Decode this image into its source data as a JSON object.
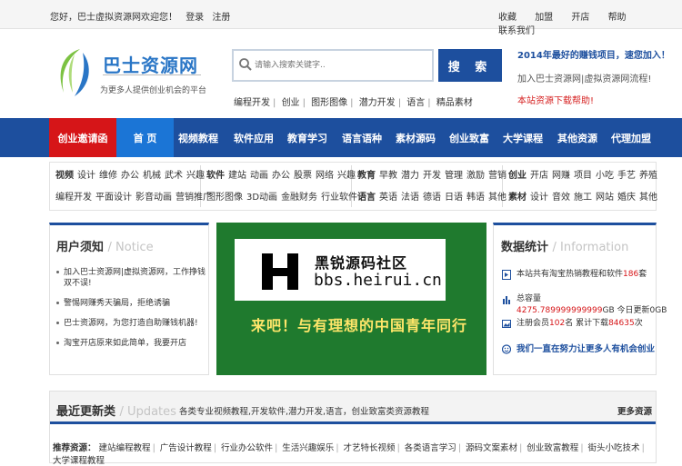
{
  "topbar": {
    "welcome": "您好，巴士虚拟资源网欢迎您！",
    "login": "登录",
    "register": "注册",
    "right_links": [
      "收藏",
      "加盟",
      "开店",
      "帮助",
      "联系我们"
    ]
  },
  "header": {
    "logo_text": "巴士资源网",
    "logo_sub": "为更多人提供创业机会的平台",
    "search_placeholder": "请输入搜索关键字..",
    "search_button": "搜 索",
    "hot_words": [
      "编程开发",
      "创业",
      "图形图像",
      "潜力开发",
      "语言",
      "精品素材"
    ],
    "promo_title": "2014年最好的赚钱项目，速您加入！",
    "promo_line": "加入巴士资源网|虚拟资源网流程!",
    "promo_help": "本站资源下载帮助!"
  },
  "nav": {
    "items": [
      "创业邀请函",
      "首 页",
      "视频教程",
      "软件应用",
      "教育学习",
      "语言语种",
      "素材源码",
      "创业致富",
      "大学课程",
      "其他资源",
      "代理加盟"
    ]
  },
  "categories": [
    {
      "rows": [
        {
          "head": "视频",
          "items": [
            "设计",
            "维修",
            "办公",
            "机械",
            "武术",
            "兴趣"
          ]
        },
        {
          "head": "",
          "items": [
            "编程开发",
            "平面设计",
            "影音动画",
            "营销推广"
          ]
        }
      ]
    },
    {
      "rows": [
        {
          "head": "软件",
          "items": [
            "建站",
            "动画",
            "办公",
            "股票",
            "网络",
            "兴趣"
          ]
        },
        {
          "head": "",
          "items": [
            "图形图像",
            "3D动画",
            "金融财务",
            "行业软件"
          ]
        }
      ]
    },
    {
      "rows": [
        {
          "head": "教育",
          "items": [
            "早教",
            "潜力",
            "开发",
            "管理",
            "激励",
            "营销"
          ]
        },
        {
          "head": "语言",
          "items": [
            "英语",
            "法语",
            "德语",
            "日语",
            "韩语",
            "其他"
          ]
        }
      ]
    },
    {
      "rows": [
        {
          "head": "创业",
          "items": [
            "开店",
            "网赚",
            "项目",
            "小吃",
            "手艺",
            "养殖"
          ]
        },
        {
          "head": "素材",
          "items": [
            "设计",
            "音效",
            "施工",
            "网站",
            "婚庆",
            "其他"
          ]
        }
      ]
    }
  ],
  "notice": {
    "title": "用户须知",
    "title_en": "/ Notice",
    "items": [
      "加入巴士资源网|虚拟资源网，工作挣钱双不误!",
      "警惕网赚秀天骗局，拒绝诱骗",
      "巴士资源网，为您打造自助赚钱机器!",
      "淘宝开店原来如此简单，我要开店"
    ]
  },
  "banner": {
    "logo_letter": "H",
    "cn_name": "黑锐源码社区",
    "url": "bbs.heirui.cn",
    "slogan": "来吧！与有理想的中国青年同行"
  },
  "stats": {
    "title": "数据统计",
    "title_en": "/ Information",
    "line1_pre": "本站共有淘宝热销教程和软件",
    "line1_num": "186",
    "line1_post": "套",
    "line2_pre": "总容量",
    "line2_num": "4275.789999999999",
    "line2_post": "GB 今日更新0GB",
    "line3_pre": "注册会员",
    "line3_num": "102",
    "line3_mid": "名 累计下载",
    "line3_num2": "84635",
    "line3_post": "次",
    "slogan": "我们一直在努力让更多人有机会创业"
  },
  "updates": {
    "title": "最近更新类",
    "title_en": "/ Updates",
    "desc": "各类专业视频教程,开发软件,潜力开发,语言，创业致富类资源教程",
    "more": "更多资源",
    "rec_label": "推荐资源：",
    "links": [
      "建站编程教程",
      "广告设计教程",
      "行业办公软件",
      "生活兴趣娱乐",
      "才艺特长视频",
      "各类语言学习",
      "源码文案素材",
      "创业致富教程",
      "街头小吃技术",
      "大学课程教程"
    ]
  },
  "colors": {
    "primary": "#1d4f9e",
    "nav_red": "#d61518",
    "nav_active": "#1b75d6",
    "banner_green": "#1f7a2e",
    "accent_red": "#d62222"
  }
}
